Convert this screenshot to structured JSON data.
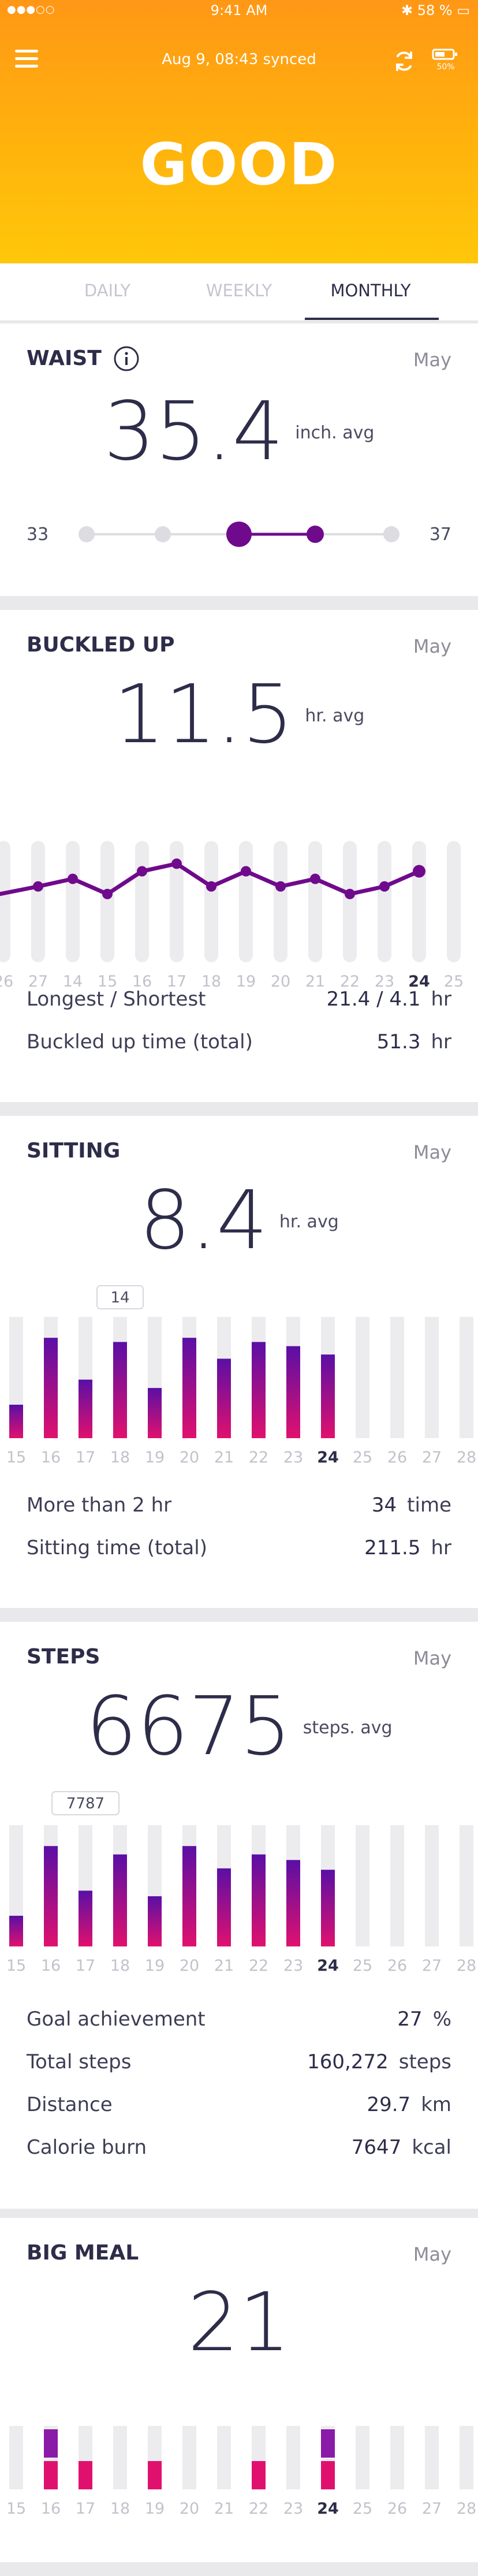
{
  "status_bar": {
    "signal": "●●●○○",
    "time": "9:41 AM",
    "battery": "58 %"
  },
  "header": {
    "synced_text": "Aug 9, 08:43 synced",
    "device_battery": "50%",
    "status_word": "GOOD"
  },
  "tabs": [
    "DAILY",
    "WEEKLY",
    "MONTHLY"
  ],
  "active_tab": "MONTHLY",
  "waist": {
    "title": "WAIST",
    "month": "May",
    "value": "35.4",
    "unit": "inch. avg",
    "min_label": "33",
    "max_label": "37",
    "range_low": 35,
    "range_high": 36
  },
  "buckled": {
    "title": "BUCKLED UP",
    "month": "May",
    "value": "11.5",
    "unit": "hr. avg",
    "days": [
      "26",
      "27",
      "14",
      "15",
      "16",
      "17",
      "18",
      "19",
      "20",
      "21",
      "22",
      "23",
      "24",
      "25",
      "26"
    ],
    "highlight_day": "24",
    "longest_shortest_label": "Longest / Shortest",
    "longest_shortest_value": "21.4 / 4.1",
    "longest_shortest_unit": "hr",
    "total_label": "Buckled up time (total)",
    "total_value": "51.3",
    "total_unit": "hr"
  },
  "sitting": {
    "title": "SITTING",
    "month": "May",
    "value": "8.4",
    "unit": "hr. avg",
    "days": [
      "15",
      "16",
      "17",
      "18",
      "19",
      "20",
      "21",
      "22",
      "23",
      "24",
      "25",
      "26",
      "27",
      "28"
    ],
    "highlight_day": "24",
    "tooltip": "14",
    "more_label": "More than 2 hr",
    "more_value": "34",
    "more_unit": "time",
    "total_label": "Sitting time (total)",
    "total_value": "211.5",
    "total_unit": "hr"
  },
  "steps": {
    "title": "STEPS",
    "month": "May",
    "value": "6675",
    "unit": "steps. avg",
    "days": [
      "15",
      "16",
      "17",
      "18",
      "19",
      "20",
      "21",
      "22",
      "23",
      "24",
      "25",
      "26",
      "27",
      "28"
    ],
    "highlight_day": "24",
    "tooltip": "7787",
    "rows": [
      {
        "label": "Goal achievement",
        "value": "27",
        "unit": "%"
      },
      {
        "label": "Total steps",
        "value": "160,272",
        "unit": "steps"
      },
      {
        "label": "Distance",
        "value": "29.7",
        "unit": "km"
      },
      {
        "label": "Calorie burn",
        "value": "7647",
        "unit": "kcal"
      }
    ]
  },
  "bigmeal": {
    "title": "BIG MEAL",
    "month": "May",
    "value": "21",
    "days": [
      "15",
      "16",
      "17",
      "18",
      "19",
      "20",
      "21",
      "22",
      "23",
      "24",
      "25",
      "26",
      "27",
      "28"
    ],
    "highlight_day": "24"
  },
  "chart_data": [
    {
      "type": "line",
      "title": "BUCKLED UP",
      "x": [
        "26",
        "27",
        "14",
        "15",
        "16",
        "17",
        "18",
        "19",
        "20",
        "21",
        "22",
        "23",
        "24",
        "25",
        "26"
      ],
      "values": [
        null,
        10,
        11,
        9,
        12,
        13,
        10,
        12,
        10,
        11,
        9,
        10,
        12,
        null,
        null
      ],
      "ylim": [
        0,
        16
      ]
    },
    {
      "type": "bar",
      "title": "SITTING",
      "categories": [
        "15",
        "16",
        "17",
        "18",
        "19",
        "20",
        "21",
        "22",
        "23",
        "24",
        "25",
        "26",
        "27",
        "28"
      ],
      "values": [
        4,
        12,
        7,
        11.5,
        6,
        12,
        9.5,
        11.5,
        11,
        10,
        0,
        0,
        0,
        0
      ],
      "ylim": [
        0,
        14.5
      ]
    },
    {
      "type": "bar",
      "title": "STEPS",
      "categories": [
        "15",
        "16",
        "17",
        "18",
        "19",
        "20",
        "21",
        "22",
        "23",
        "24",
        "25",
        "26",
        "27",
        "28"
      ],
      "values": [
        2200,
        7200,
        4000,
        6600,
        3600,
        7200,
        5600,
        6600,
        6200,
        5500,
        0,
        0,
        0,
        0
      ],
      "ylim": [
        0,
        8700
      ]
    },
    {
      "type": "bar",
      "title": "BIG MEAL",
      "categories": [
        "15",
        "16",
        "17",
        "18",
        "19",
        "20",
        "21",
        "22",
        "23",
        "24",
        "25",
        "26",
        "27",
        "28"
      ],
      "values": [
        0,
        2,
        1,
        0,
        1,
        0,
        0,
        1,
        0,
        2,
        0,
        0,
        0,
        0
      ],
      "ylim": [
        0,
        2
      ]
    }
  ],
  "colors": {
    "accent_orange": "#ff9716",
    "accent_yellow": "#ffc70a",
    "purple": "#6f0a8c",
    "bar_top": "#5a0fa5",
    "bar_bottom": "#e0116e",
    "track": "#ececef",
    "text": "#2d2d4a"
  }
}
